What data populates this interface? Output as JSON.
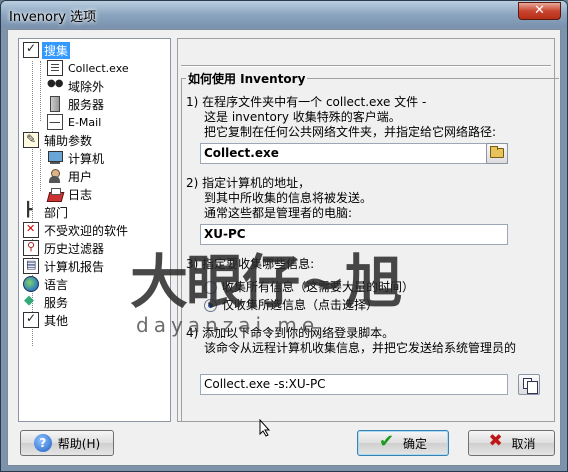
{
  "window": {
    "title": "Invenory 选项",
    "close_glyph": "✕"
  },
  "tree": {
    "items": [
      {
        "label": "搜集",
        "icon": "checklist-icon",
        "selected": true
      },
      {
        "label": "Collect.exe",
        "icon": "page-icon"
      },
      {
        "label": "域除外",
        "icon": "binoculars-icon"
      },
      {
        "label": "服务器",
        "icon": "server-icon"
      },
      {
        "label": "E-Mail",
        "icon": "mail-icon"
      },
      {
        "label": "辅助参数",
        "icon": "edit-icon"
      },
      {
        "label": "计算机",
        "icon": "computer-icon"
      },
      {
        "label": "用户",
        "icon": "user-icon"
      },
      {
        "label": "日志",
        "icon": "log-icon"
      },
      {
        "label": "部门",
        "icon": "org-tree-icon"
      },
      {
        "label": "不受欢迎的软件",
        "icon": "blocked-icon"
      },
      {
        "label": "历史过滤器",
        "icon": "filter-icon"
      },
      {
        "label": "计算机报告",
        "icon": "report-icon"
      },
      {
        "label": "语言",
        "icon": "globe-icon"
      },
      {
        "label": "服务",
        "icon": "service-icon"
      },
      {
        "label": "其他",
        "icon": "other-icon"
      }
    ]
  },
  "panel": {
    "group_title": "如何使用 Inventory",
    "step1": {
      "lines": [
        "1) 在程序文件夹中有一个 collect.exe 文件 -",
        "这是 inventory 收集特殊的客户端。",
        "把它复制在任何公共网络文件夹，并指定给它网络路径:"
      ],
      "value": "Collect.exe"
    },
    "step2": {
      "lines": [
        "2) 指定计算机的地址，",
        "到其中所收集的信息将被发送。",
        "通常这些都是管理者的电脑:"
      ],
      "value": "XU-PC"
    },
    "step3": {
      "line": "3) 指定要收集哪些信息:",
      "options": [
        {
          "label": "收集所有信息（这需要大量的时间）",
          "checked": false
        },
        {
          "label": "仅收集所选信息（点击选择）",
          "checked": true
        }
      ]
    },
    "step4": {
      "lines": [
        "4) 添加以下命令到你的网络登录脚本。",
        "该命令从远程计算机收集信息，并把它发送给系统管理员的"
      ],
      "value": "Collect.exe -s:XU-PC"
    }
  },
  "buttons": {
    "help": "帮助(H)",
    "help_glyph": "?",
    "ok": "确定",
    "cancel": "取消"
  },
  "watermark": {
    "big": "大眼仔~旭",
    "small": "dayanzai.me"
  }
}
